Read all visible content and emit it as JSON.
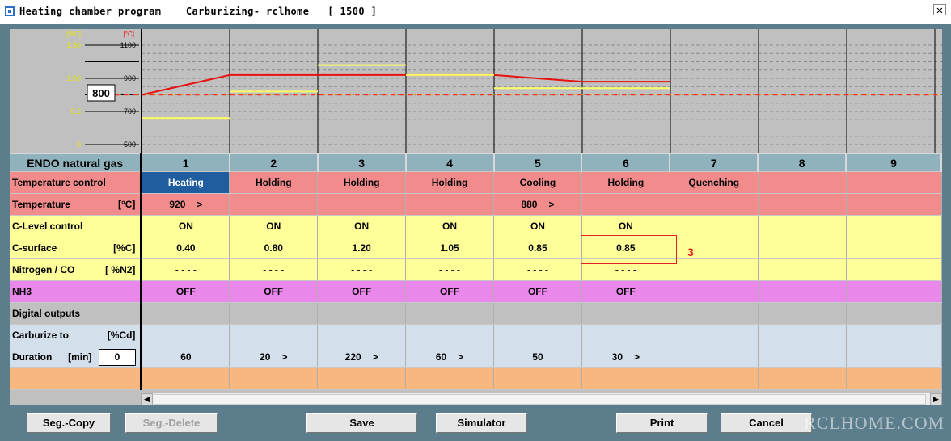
{
  "window": {
    "title": "Heating chamber program    Carburizing- rclhome   [ 1500 ]",
    "close_glyph": "✕"
  },
  "colors": {
    "temperature_line": "#e81010",
    "carbon_line": "#ffff66",
    "setpoint_dash": "#ff3030",
    "temp_row": "#f28b8b",
    "carbon_rows": "#ffff99",
    "nh3_row": "#ea87ea",
    "duration_rows": "#d3e0ec",
    "active_cell": "#1f5d9e"
  },
  "chart": {
    "carbon_unit": "[%C]",
    "temp_unit": "[°C]",
    "carbon_ticks": [
      "1.50",
      "1.00",
      "0.5",
      "0"
    ],
    "temp_ticks": [
      "1100",
      "900",
      "700",
      "500"
    ],
    "setpoint_box": "800",
    "chart_data": {
      "type": "line",
      "x": [
        1,
        2,
        3,
        4,
        5,
        6,
        7,
        8,
        9
      ],
      "series": [
        {
          "values": [
            [
              800,
              920
            ],
            [
              920,
              920
            ],
            [
              920,
              920
            ],
            [
              920,
              920
            ],
            [
              920,
              880
            ],
            [
              880,
              880
            ]
          ]
        },
        {
          "values": [
            0.4,
            0.8,
            1.2,
            1.05,
            0.85,
            0.85
          ]
        }
      ],
      "temp_ylim": [
        500,
        1100
      ],
      "carbon_ylim": [
        0,
        1.5
      ],
      "setpoint": 800,
      "grid": true
    }
  },
  "table": {
    "atmosphere": "ENDO natural gas",
    "columns": [
      "1",
      "2",
      "3",
      "4",
      "5",
      "6",
      "7",
      "8",
      "9"
    ],
    "rows": {
      "temp_control": {
        "label": "Temperature control",
        "values": [
          "Heating",
          "Holding",
          "Holding",
          "Holding",
          "Cooling",
          "Holding",
          "Quenching",
          "",
          ""
        ]
      },
      "temperature": {
        "label": "Temperature",
        "unit": "[°C]",
        "values": [
          "920",
          "",
          "",
          "",
          "880",
          "",
          "",
          "",
          ""
        ],
        "arrows": [
          ">",
          "",
          "",
          "",
          ">",
          "",
          "",
          "",
          ""
        ]
      },
      "clevel": {
        "label": "C-Level control",
        "values": [
          "ON",
          "ON",
          "ON",
          "ON",
          "ON",
          "ON",
          "",
          "",
          ""
        ]
      },
      "csurface": {
        "label": "C-surface",
        "unit": "[%C]",
        "values": [
          "0.40",
          "0.80",
          "1.20",
          "1.05",
          "0.85",
          "0.85",
          "",
          "",
          ""
        ]
      },
      "nitrogen": {
        "label": "Nitrogen / CO",
        "unit": "[ %N2]",
        "values": [
          "- - - -",
          "- - - -",
          "- - - -",
          "- - - -",
          "- - - -",
          "- - - -",
          "",
          "",
          ""
        ]
      },
      "nh3": {
        "label": "NH3",
        "values": [
          "OFF",
          "OFF",
          "OFF",
          "OFF",
          "OFF",
          "OFF",
          "",
          "",
          ""
        ]
      },
      "digital": {
        "label": "Digital outputs"
      },
      "carburize": {
        "label": "Carburize to",
        "unit": "[%Cd]"
      },
      "duration": {
        "label": "Duration",
        "unit": "[min]",
        "input_value": "0",
        "values": [
          "60",
          "20",
          "220",
          "60",
          "50",
          "30",
          "",
          "",
          ""
        ],
        "arrows": [
          "",
          ">",
          ">",
          ">",
          "",
          ">",
          "",
          "",
          ""
        ]
      }
    }
  },
  "annotation": "3",
  "buttons": {
    "seg_copy": "Seg.-Copy",
    "seg_delete": "Seg.-Delete",
    "save": "Save",
    "simulator": "Simulator",
    "print": "Print",
    "cancel": "Cancel"
  },
  "watermark": "RCLHOME.COM"
}
